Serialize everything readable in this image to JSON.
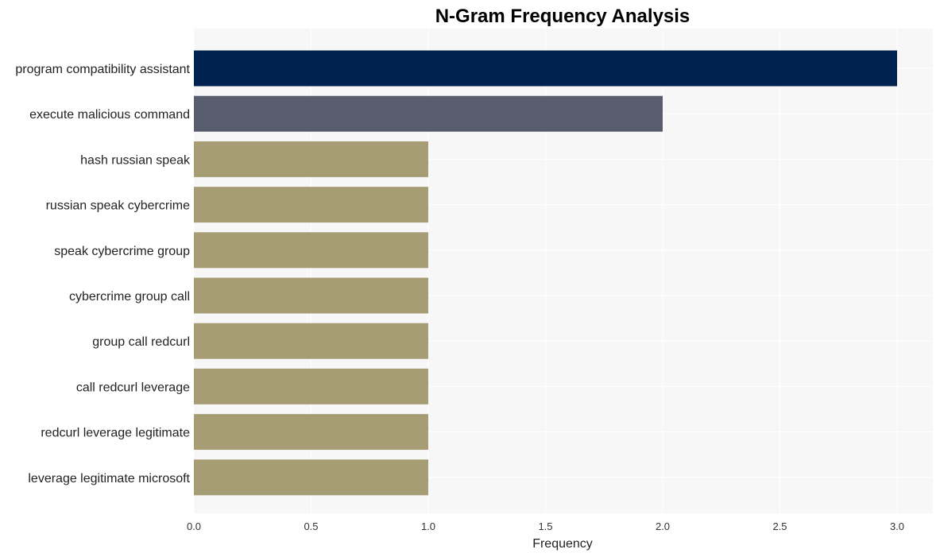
{
  "chart_data": {
    "type": "bar",
    "orientation": "horizontal",
    "title": "N-Gram Frequency Analysis",
    "xlabel": "Frequency",
    "ylabel": "",
    "xlim": [
      0,
      3.15
    ],
    "xticks": [
      "0.0",
      "0.5",
      "1.0",
      "1.5",
      "2.0",
      "2.5",
      "3.0"
    ],
    "grid": true,
    "categories": [
      "program compatibility assistant",
      "execute malicious command",
      "hash russian speak",
      "russian speak cybercrime",
      "speak cybercrime group",
      "cybercrime group call",
      "group call redcurl",
      "call redcurl leverage",
      "redcurl leverage legitimate",
      "leverage legitimate microsoft"
    ],
    "values": [
      3,
      2,
      1,
      1,
      1,
      1,
      1,
      1,
      1,
      1
    ],
    "colors": [
      "#00224e",
      "#575d6d",
      "#a69d75",
      "#a69d75",
      "#a69d75",
      "#a69d75",
      "#a69d75",
      "#a69d75",
      "#a69d75",
      "#a69d75"
    ],
    "background": "#f7f7f7"
  }
}
